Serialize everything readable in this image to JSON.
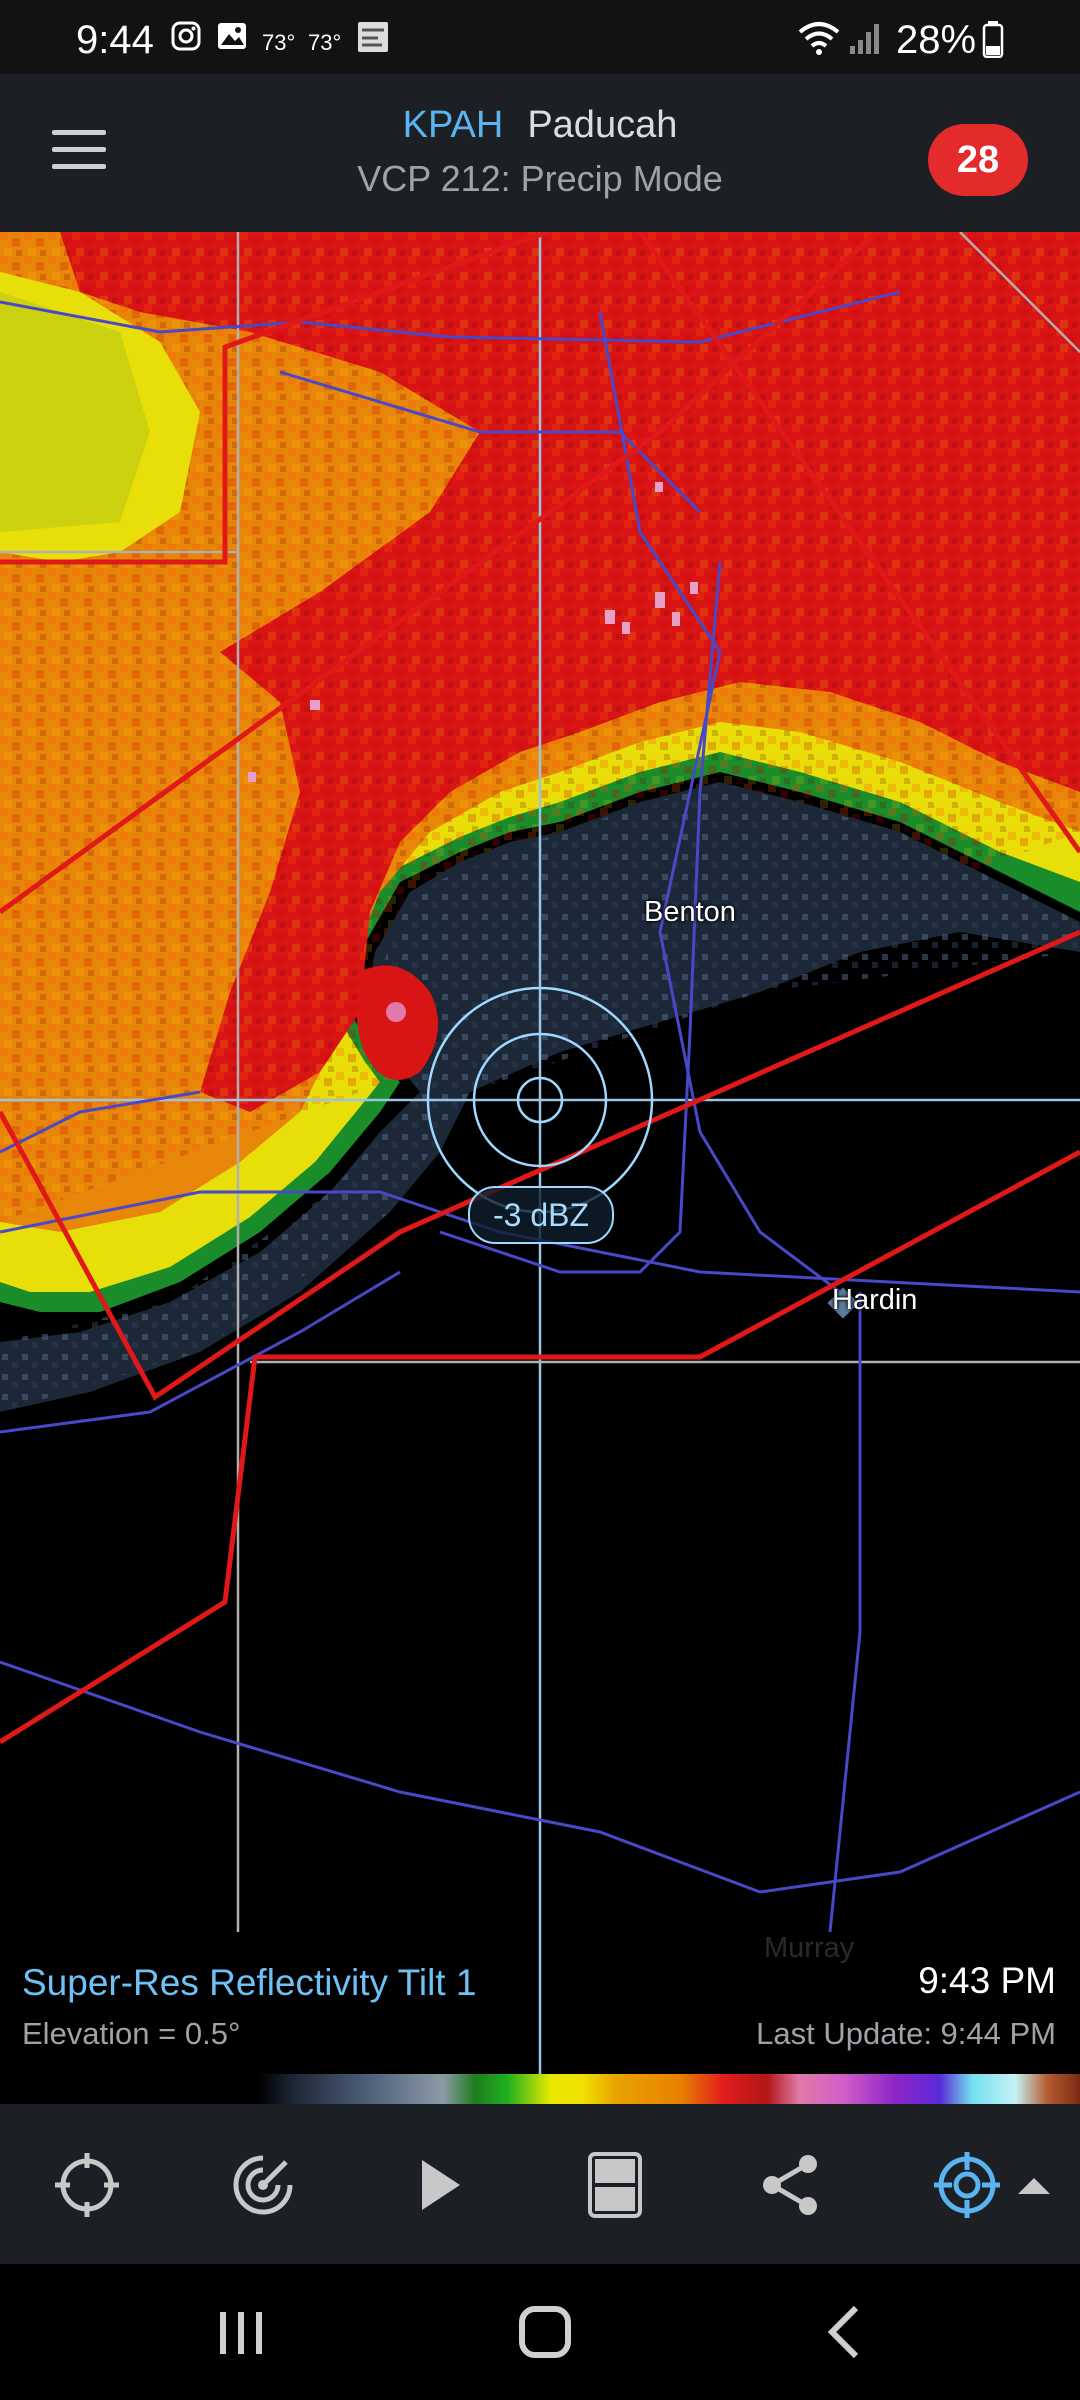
{
  "status_bar": {
    "time": "9:44",
    "temp_1": "73°",
    "temp_2": "73°",
    "battery": "28%"
  },
  "header": {
    "station_code": "KPAH",
    "station_name": "Paducah",
    "vcp": "VCP 212: Precip Mode",
    "alert_count": "28"
  },
  "map": {
    "cities": [
      "Benton",
      "Hardin",
      "Murray"
    ],
    "probe_readout": "-3 dBZ"
  },
  "product": {
    "name": "Super-Res Reflectivity Tilt 1",
    "elevation": "Elevation = 0.5°",
    "scan_time": "9:43 PM",
    "last_update": "Last Update: 9:44 PM"
  },
  "toolbar": {
    "icons": [
      "locate-icon",
      "radar-sweep-icon",
      "play-icon",
      "split-view-icon",
      "share-icon",
      "layers-target-icon"
    ]
  },
  "colors": {
    "accent": "#5ab4f0",
    "alert_badge": "#e32b2b",
    "warning_polygon": "#e01818"
  }
}
